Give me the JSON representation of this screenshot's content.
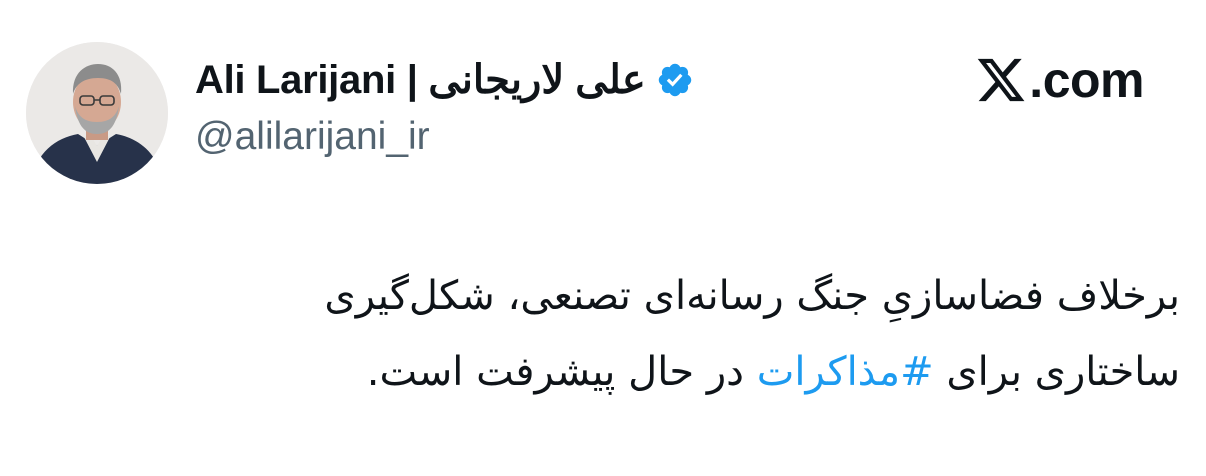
{
  "author": {
    "display_name": "Ali Larijani | علی لاریجانی",
    "handle": "@alilarijani_ir",
    "avatar_icon": "profile-photo",
    "verified_icon": "verified-badge-icon"
  },
  "brand": {
    "logo_icon": "x-logo-icon",
    "text": ".com"
  },
  "tweet": {
    "line1": "برخلاف فضاسازیِ جنگ رسانه‌ای تصنعی، شکل‌گیری",
    "line2_before": "ساختاری برای ",
    "hashtag": "#مذاکرات",
    "line2_after": " در حال پیشرفت است."
  },
  "colors": {
    "text": "#0f1419",
    "secondary": "#536471",
    "accent": "#1d9bf0"
  }
}
